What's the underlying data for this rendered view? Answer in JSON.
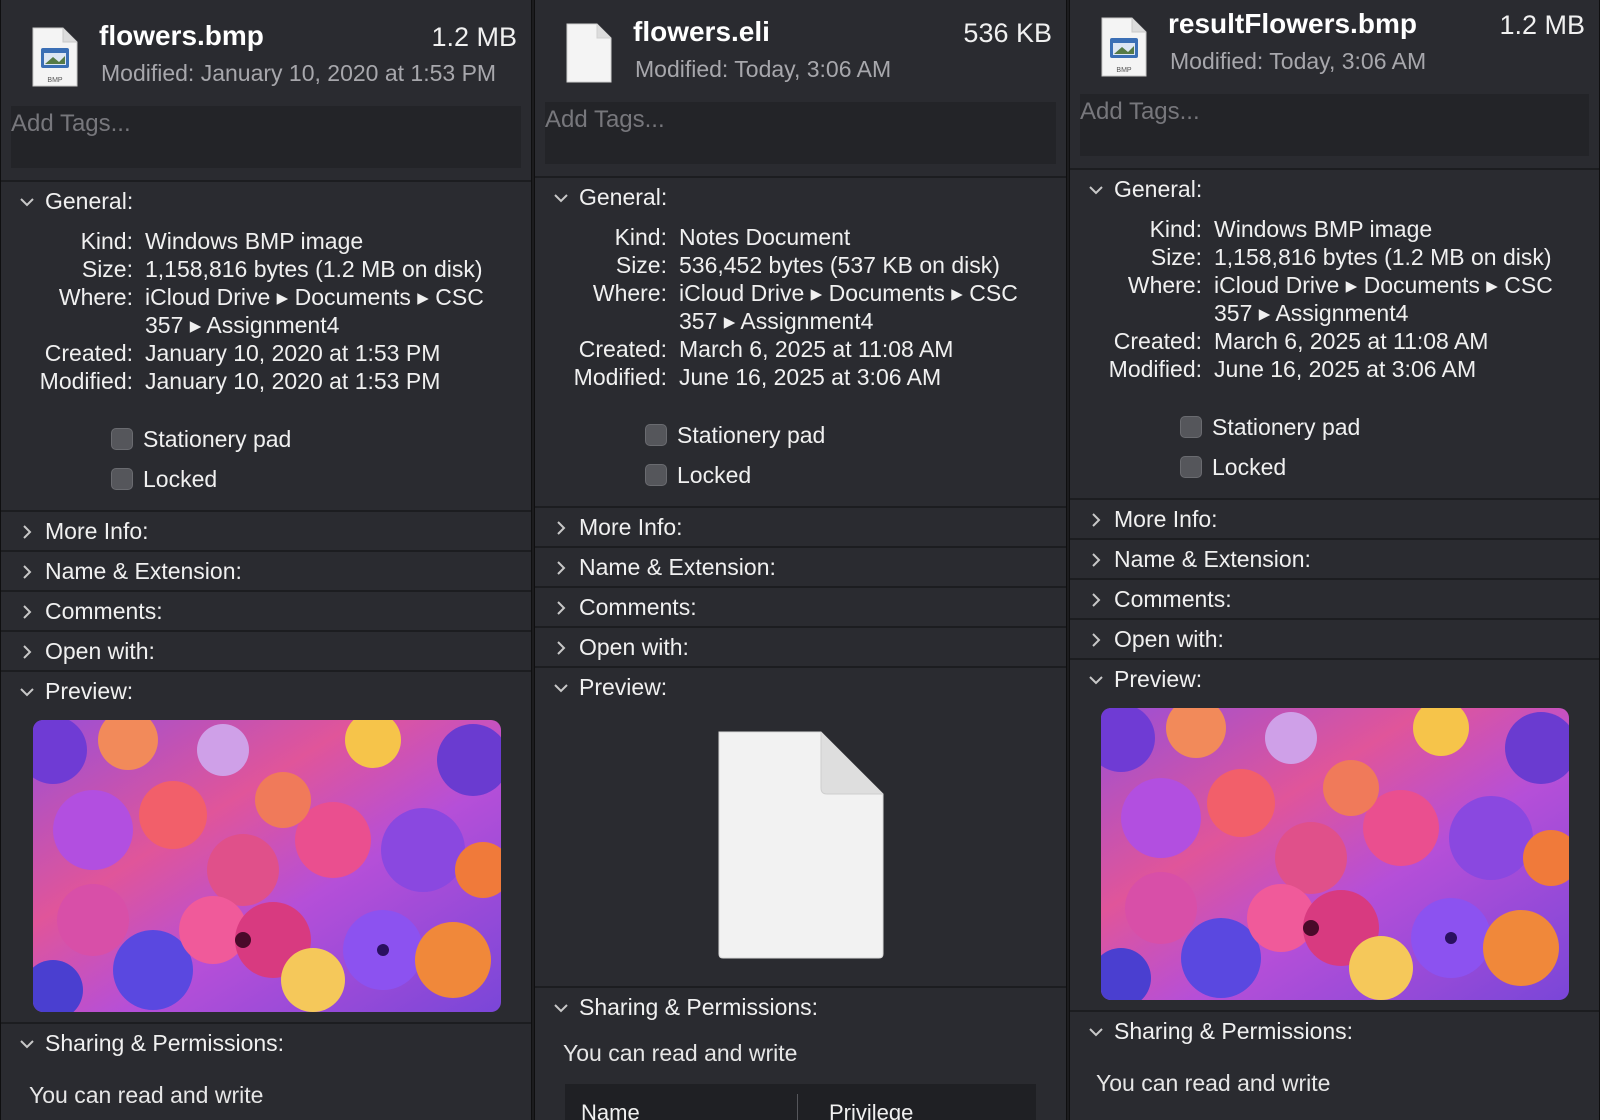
{
  "panels": [
    {
      "file_name": "flowers.bmp",
      "file_size": "1.2 MB",
      "modified_summary": "Modified: January 10, 2020 at 1:53 PM",
      "icon": "bmp-file-icon",
      "icon_badge": "BMP",
      "tags_placeholder": "Add Tags...",
      "general_label": "General:",
      "info": [
        {
          "key": "Kind:",
          "value": "Windows BMP image"
        },
        {
          "key": "Size:",
          "value": "1,158,816 bytes (1.2 MB on disk)"
        },
        {
          "key": "Where:",
          "value": "iCloud Drive ▸ Documents ▸ CSC"
        },
        {
          "key": "",
          "value": "357 ▸ Assignment4"
        },
        {
          "key": "Created:",
          "value": "January 10, 2020 at 1:53 PM"
        },
        {
          "key": "Modified:",
          "value": "January 10, 2020 at 1:53 PM"
        }
      ],
      "stationery_label": "Stationery pad",
      "locked_label": "Locked",
      "sections": [
        "More Info:",
        "Name & Extension:",
        "Comments:",
        "Open with:"
      ],
      "preview_label": "Preview:",
      "preview": "flower-image",
      "sharing_label": "Sharing & Permissions:",
      "permission_text": "You can read and write"
    },
    {
      "file_name": "flowers.eli",
      "file_size": "536 KB",
      "modified_summary": "Modified: Today, 3:06 AM",
      "icon": "blank-document-icon",
      "tags_placeholder": "Add Tags...",
      "general_label": "General:",
      "info": [
        {
          "key": "Kind:",
          "value": "Notes Document"
        },
        {
          "key": "Size:",
          "value": "536,452 bytes (537 KB on disk)"
        },
        {
          "key": "Where:",
          "value": "iCloud Drive ▸ Documents ▸ CSC"
        },
        {
          "key": "",
          "value": "357 ▸ Assignment4"
        },
        {
          "key": "Created:",
          "value": "March 6, 2025 at 11:08 AM"
        },
        {
          "key": "Modified:",
          "value": "June 16, 2025 at 3:06 AM"
        }
      ],
      "stationery_label": "Stationery pad",
      "locked_label": "Locked",
      "sections": [
        "More Info:",
        "Name & Extension:",
        "Comments:",
        "Open with:"
      ],
      "preview_label": "Preview:",
      "preview": "blank-document",
      "sharing_label": "Sharing & Permissions:",
      "permission_text": "You can read and write",
      "permission_table_headers": [
        "Name",
        "Privilege"
      ]
    },
    {
      "file_name": "resultFlowers.bmp",
      "file_size": "1.2 MB",
      "modified_summary": "Modified: Today, 3:06 AM",
      "icon": "bmp-file-icon",
      "icon_badge": "BMP",
      "tags_placeholder": "Add Tags...",
      "general_label": "General:",
      "info": [
        {
          "key": "Kind:",
          "value": "Windows BMP image"
        },
        {
          "key": "Size:",
          "value": "1,158,816 bytes (1.2 MB on disk)"
        },
        {
          "key": "Where:",
          "value": "iCloud Drive ▸ Documents ▸ CSC"
        },
        {
          "key": "",
          "value": "357 ▸ Assignment4"
        },
        {
          "key": "Created:",
          "value": "March 6, 2025 at 11:08 AM"
        },
        {
          "key": "Modified:",
          "value": "June 16, 2025 at 3:06 AM"
        }
      ],
      "stationery_label": "Stationery pad",
      "locked_label": "Locked",
      "sections": [
        "More Info:",
        "Name & Extension:",
        "Comments:",
        "Open with:"
      ],
      "preview_label": "Preview:",
      "preview": "flower-image",
      "sharing_label": "Sharing & Permissions:",
      "permission_text": "You can read and write"
    }
  ]
}
